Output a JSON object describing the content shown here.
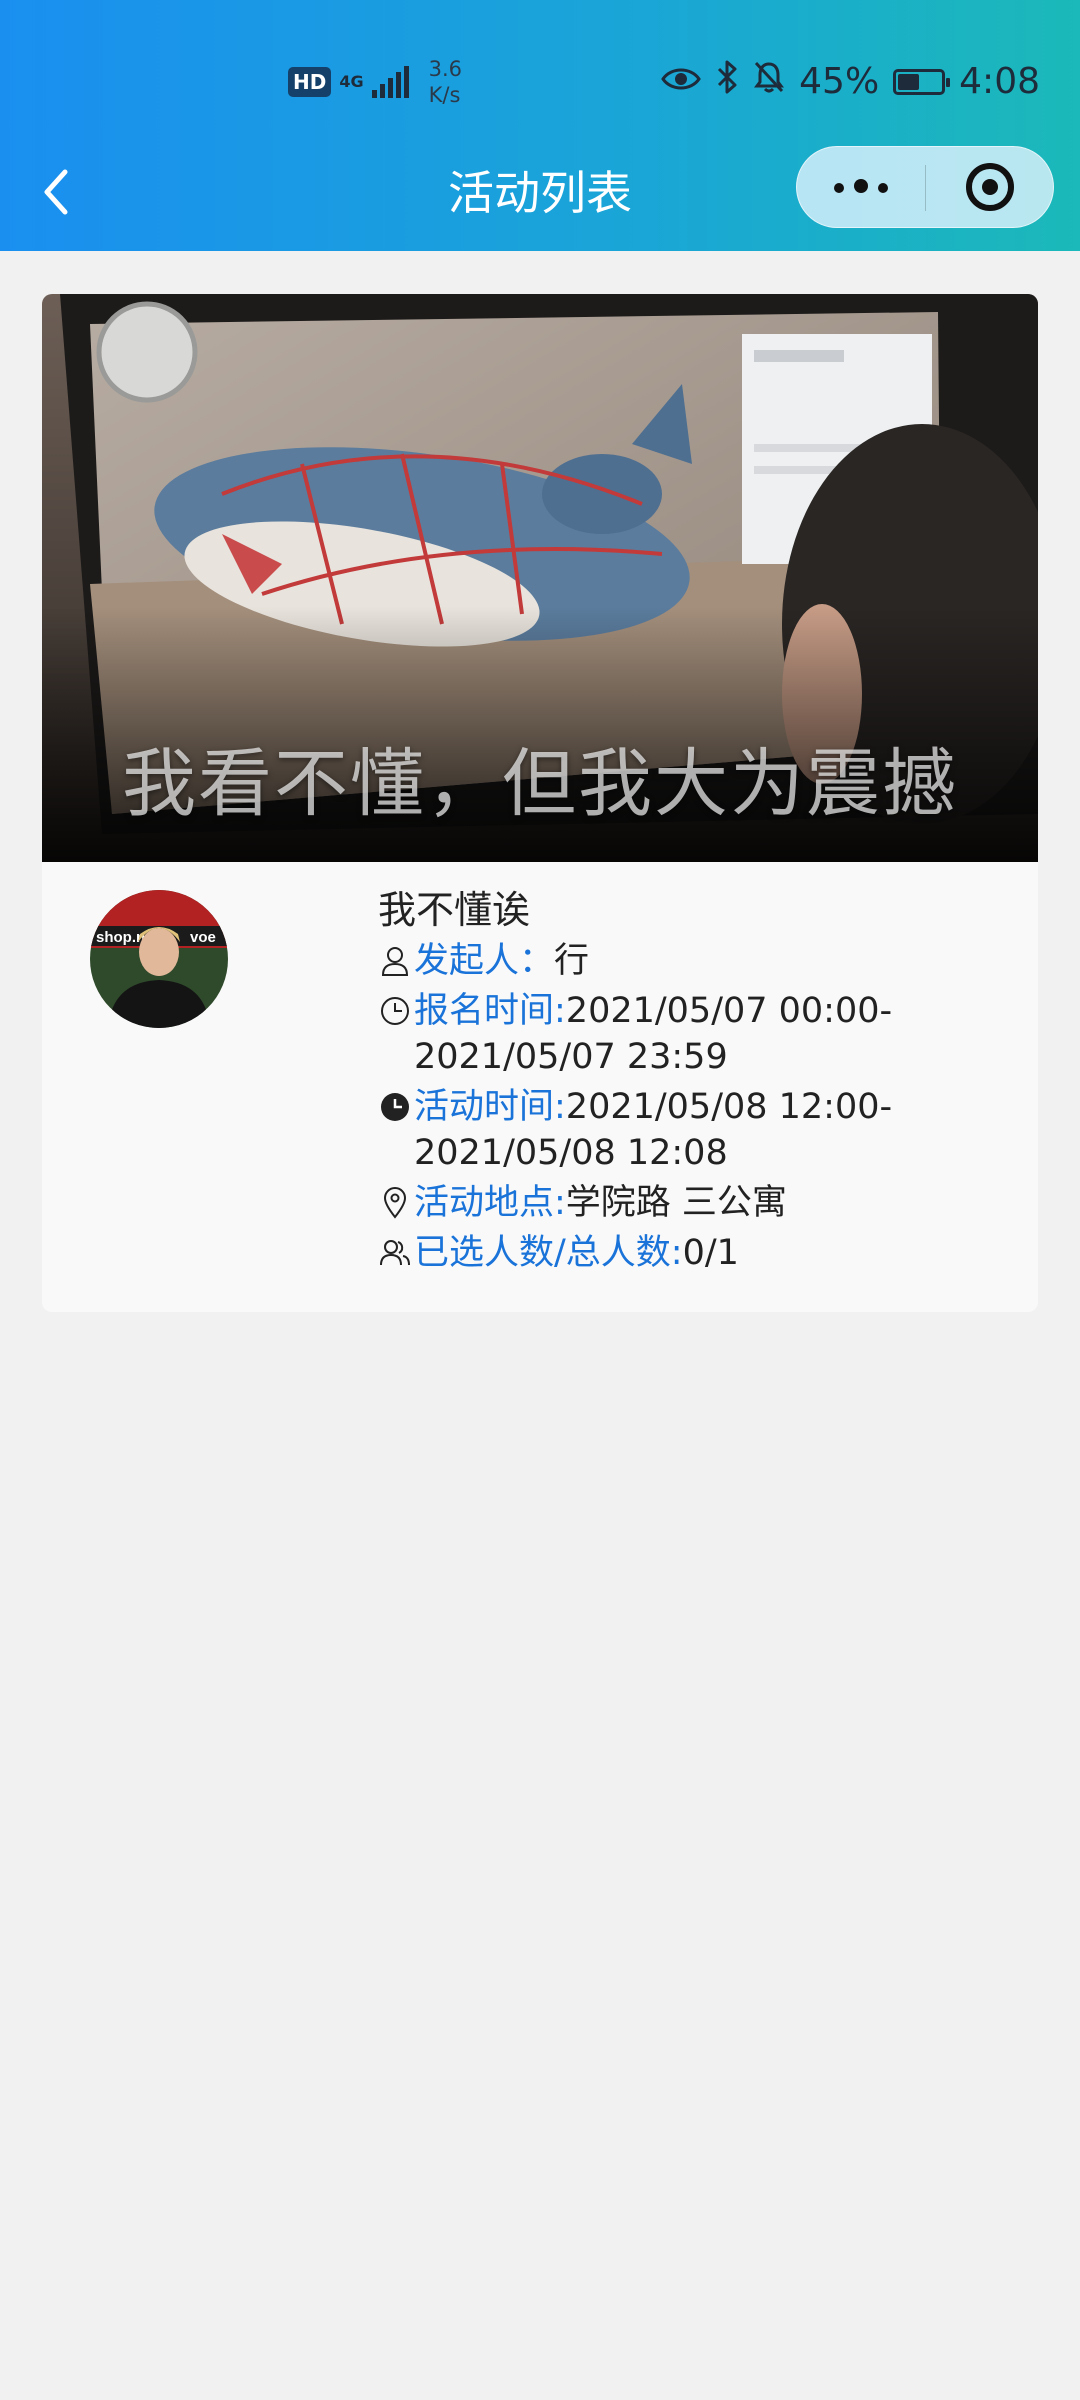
{
  "status_bar": {
    "hd": "HD",
    "network": "4G",
    "speed_value": "3.6",
    "speed_unit": "K/s",
    "battery": "45%",
    "battery_level": 0.45,
    "time": "4:08",
    "icons": [
      "eye-icon",
      "bluetooth-icon",
      "bell-off-icon",
      "battery-icon"
    ]
  },
  "nav": {
    "title": "活动列表",
    "back_icon": "chevron-left-icon",
    "more_icon": "more-dots-icon",
    "close_icon": "target-icon"
  },
  "activity": {
    "banner_caption": "我不懂诶",
    "banner_overlay_text": "我看不懂，但我大为震撼",
    "title": "我不懂诶",
    "organizer_label": "发起人：",
    "organizer": "行",
    "signup_label": "报名时间:",
    "signup_time": "2021/05/07 00:00-2021/05/07 23:59",
    "event_label": "活动时间:",
    "event_time": "2021/05/08 12:00-2021/05/08 12:08",
    "location_label": "活动地点:",
    "location": "学院路 三公寓",
    "count_label": "已选人数/总人数:",
    "count": "0/1"
  },
  "colors": {
    "header_start": "#1a8ff0",
    "header_end": "#1bb9b9",
    "label_blue": "#1a73d9",
    "page_bg": "#f1f1f1"
  }
}
